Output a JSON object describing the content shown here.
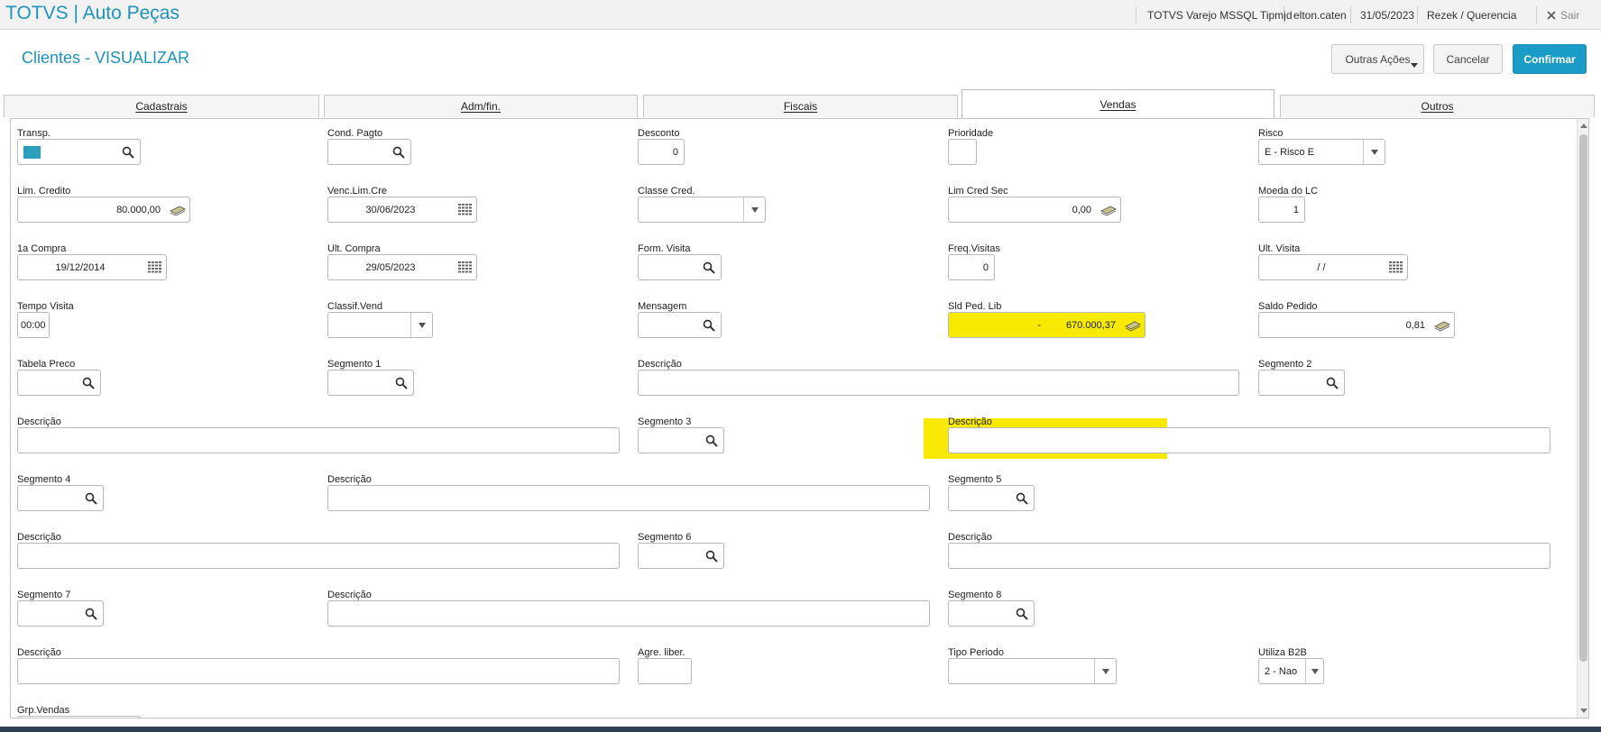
{
  "app": {
    "title": "TOTVS | Auto Peças"
  },
  "topbar": {
    "environment": "TOTVS Varejo MSSQL Tipmjd",
    "user": "elton.caten",
    "date": "31/05/2023",
    "branch": "Rezek / Querencia",
    "exit_label": "Sair"
  },
  "header": {
    "title": "Clientes - VISUALIZAR",
    "more_actions": "Outras Ações",
    "cancel": "Cancelar",
    "confirm": "Confirmar"
  },
  "tabs": [
    {
      "label": "Cadastrais"
    },
    {
      "label": "Adm/fin."
    },
    {
      "label": "Fiscais"
    },
    {
      "label": "Vendas",
      "active": true
    },
    {
      "label": "Outros"
    }
  ],
  "form": {
    "transp": {
      "label": "Transp.",
      "value": ""
    },
    "cond_pagto": {
      "label": "Cond. Pagto",
      "value": ""
    },
    "desconto": {
      "label": "Desconto",
      "value": "0"
    },
    "prioridade": {
      "label": "Prioridade",
      "value": ""
    },
    "risco": {
      "label": "Risco",
      "value": "E - Risco E"
    },
    "lim_credito": {
      "label": "Lim. Credito",
      "value": "80.000,00"
    },
    "venc_lim_cre": {
      "label": "Venc.Lim.Cre",
      "value": "30/06/2023"
    },
    "classe_cred": {
      "label": "Classe Cred.",
      "value": ""
    },
    "lim_cred_sec": {
      "label": "Lim Cred Sec",
      "value": "0,00"
    },
    "moeda_lc": {
      "label": "Moeda do LC",
      "value": "1"
    },
    "primeira_compra": {
      "label": "1a Compra",
      "value": "19/12/2014"
    },
    "ult_compra": {
      "label": "Ult. Compra",
      "value": "29/05/2023"
    },
    "form_visita": {
      "label": "Form. Visita",
      "value": ""
    },
    "freq_visitas": {
      "label": "Freq.Visitas",
      "value": "0"
    },
    "ult_visita": {
      "label": "Ult. Visita",
      "value": "/  /"
    },
    "tempo_visita": {
      "label": "Tempo Visita",
      "value": "00:00"
    },
    "classif_vend": {
      "label": "Classif.Vend",
      "value": ""
    },
    "mensagem": {
      "label": "Mensagem",
      "value": ""
    },
    "sld_ped_lib": {
      "label": "Sld Ped. Lib",
      "sign": "-",
      "value": "670.000,37"
    },
    "saldo_pedido": {
      "label": "Saldo Pedido",
      "value": "0,81"
    },
    "tabela_preco": {
      "label": "Tabela Preco",
      "value": ""
    },
    "segmento_1": {
      "label": "Segmento 1",
      "value": ""
    },
    "descricao_1": {
      "label": "Descrição",
      "value": ""
    },
    "segmento_2": {
      "label": "Segmento 2",
      "value": ""
    },
    "descricao_2": {
      "label": "Descrição",
      "value": ""
    },
    "segmento_3": {
      "label": "Segmento 3",
      "value": ""
    },
    "descricao_3": {
      "label": "Descrição",
      "value": ""
    },
    "segmento_4": {
      "label": "Segmento 4",
      "value": ""
    },
    "descricao_4": {
      "label": "Descrição",
      "value": ""
    },
    "segmento_5": {
      "label": "Segmento 5",
      "value": ""
    },
    "descricao_5": {
      "label": "Descrição",
      "value": ""
    },
    "segmento_6": {
      "label": "Segmento 6",
      "value": ""
    },
    "descricao_6": {
      "label": "Descrição",
      "value": ""
    },
    "segmento_7": {
      "label": "Segmento 7",
      "value": ""
    },
    "descricao_7": {
      "label": "Descrição",
      "value": ""
    },
    "segmento_8": {
      "label": "Segmento 8",
      "value": ""
    },
    "descricao_8": {
      "label": "Descrição",
      "value": ""
    },
    "agre_liber": {
      "label": "Agre. liber.",
      "value": ""
    },
    "tipo_periodo": {
      "label": "Tipo Periodo",
      "value": ""
    },
    "utiliza_b2b": {
      "label": "Utiliza B2B",
      "value": "2 - Nao"
    },
    "grp_vendas": {
      "label": "Grp.Vendas",
      "value": ""
    }
  },
  "colors": {
    "accent": "#1e93bf",
    "confirm_button": "#1a9cc6",
    "highlight": "#f7ea00"
  },
  "icons": [
    "search-icon",
    "calendar-icon",
    "money-icon",
    "dropdown-arrow-icon",
    "close-icon"
  ]
}
